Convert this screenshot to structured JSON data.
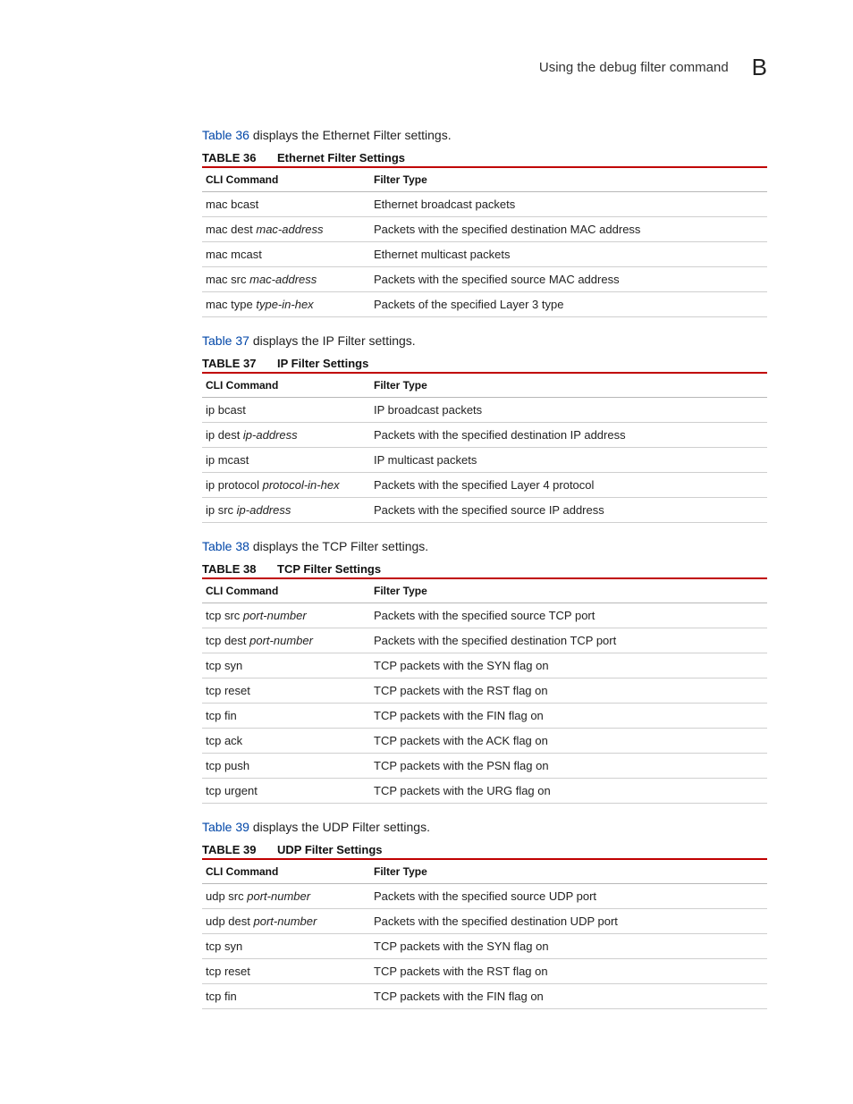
{
  "header": {
    "title": "Using the debug filter command",
    "chapter": "B"
  },
  "sections": [
    {
      "intro_ref": "Table 36",
      "intro_rest": " displays the Ethernet Filter settings.",
      "table_number": "TABLE 36",
      "table_title": "Ethernet Filter Settings",
      "columns": [
        "CLI Command",
        "Filter Type"
      ],
      "rows": [
        {
          "cmd": "mac bcast",
          "arg": "",
          "desc": "Ethernet broadcast packets"
        },
        {
          "cmd": "mac dest ",
          "arg": "mac-address",
          "desc": "Packets with the specified destination MAC address"
        },
        {
          "cmd": "mac mcast",
          "arg": "",
          "desc": "Ethernet multicast packets"
        },
        {
          "cmd": "mac src ",
          "arg": "mac-address",
          "desc": "Packets with the specified source MAC address"
        },
        {
          "cmd": "mac type ",
          "arg": "type-in-hex",
          "desc": "Packets of the specified Layer 3 type"
        }
      ]
    },
    {
      "intro_ref": "Table 37",
      "intro_rest": " displays the IP Filter settings.",
      "table_number": "TABLE 37",
      "table_title": "IP Filter Settings",
      "columns": [
        "CLI Command",
        "Filter Type"
      ],
      "rows": [
        {
          "cmd": "ip bcast",
          "arg": "",
          "desc": "IP broadcast packets"
        },
        {
          "cmd": "ip dest ",
          "arg": "ip-address",
          "desc": "Packets with the specified destination IP address"
        },
        {
          "cmd": "ip mcast",
          "arg": "",
          "desc": "IP multicast packets"
        },
        {
          "cmd": "ip protocol ",
          "arg": "protocol-in-hex",
          "desc": "Packets with the specified Layer 4 protocol"
        },
        {
          "cmd": "ip src ",
          "arg": "ip-address",
          "desc": "Packets with the specified source IP address"
        }
      ]
    },
    {
      "intro_ref": "Table 38",
      "intro_rest": " displays the TCP Filter settings.",
      "table_number": "TABLE 38",
      "table_title": "TCP Filter Settings",
      "columns": [
        "CLI Command",
        "Filter Type"
      ],
      "rows": [
        {
          "cmd": "tcp src ",
          "arg": "port-number",
          "desc": "Packets with the specified source TCP port"
        },
        {
          "cmd": "tcp dest ",
          "arg": "port-number",
          "desc": "Packets with the specified destination TCP port"
        },
        {
          "cmd": "tcp syn",
          "arg": "",
          "desc": "TCP packets with the SYN flag on"
        },
        {
          "cmd": "tcp reset",
          "arg": "",
          "desc": "TCP packets with the RST flag on"
        },
        {
          "cmd": "tcp fin",
          "arg": "",
          "desc": "TCP packets with the FIN flag on"
        },
        {
          "cmd": "tcp ack",
          "arg": "",
          "desc": "TCP packets with the ACK flag on"
        },
        {
          "cmd": "tcp push",
          "arg": "",
          "desc": "TCP packets with the PSN flag on"
        },
        {
          "cmd": "tcp urgent",
          "arg": "",
          "desc": "TCP packets with the URG flag on"
        }
      ]
    },
    {
      "intro_ref": "Table 39",
      "intro_rest": " displays the UDP Filter settings.",
      "table_number": "TABLE 39",
      "table_title": "UDP Filter Settings",
      "columns": [
        "CLI Command",
        "Filter Type"
      ],
      "rows": [
        {
          "cmd": "udp src ",
          "arg": "port-number",
          "desc": "Packets with the specified source UDP port"
        },
        {
          "cmd": "udp dest ",
          "arg": "port-number",
          "desc": "Packets with the specified destination UDP port"
        },
        {
          "cmd": "tcp syn",
          "arg": "",
          "desc": "TCP packets with the SYN flag on"
        },
        {
          "cmd": "tcp reset",
          "arg": "",
          "desc": "TCP packets with the RST flag on"
        },
        {
          "cmd": "tcp fin",
          "arg": "",
          "desc": "TCP packets with the FIN flag on"
        }
      ]
    }
  ]
}
